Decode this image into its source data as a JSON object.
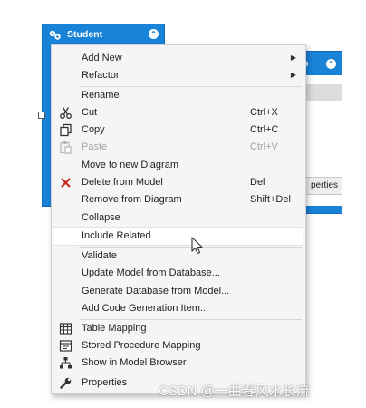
{
  "student_entity": {
    "title": "Student",
    "toggle": "⌃",
    "icon": "entity-icon"
  },
  "address_entity": {
    "title_fragment": "ess",
    "toggle": "⌃",
    "nav_fragment": "perties"
  },
  "menu": {
    "items": [
      {
        "label": "Add New",
        "submenu": true,
        "icon": null
      },
      {
        "label": "Refactor",
        "submenu": true,
        "icon": null
      },
      {
        "label": "Rename",
        "icon": null
      },
      {
        "label": "Cut",
        "shortcut": "Ctrl+X",
        "icon": "scissors-icon"
      },
      {
        "label": "Copy",
        "shortcut": "Ctrl+C",
        "icon": "copy-icon"
      },
      {
        "label": "Paste",
        "shortcut": "Ctrl+V",
        "icon": "paste-icon",
        "disabled": true
      },
      {
        "label": "Move to new Diagram",
        "icon": null
      },
      {
        "label": "Delete from Model",
        "shortcut": "Del",
        "icon": "delete-x-icon"
      },
      {
        "label": "Remove from Diagram",
        "shortcut": "Shift+Del",
        "icon": null
      },
      {
        "label": "Collapse",
        "icon": null
      },
      {
        "label": "Include Related",
        "icon": null,
        "hover": true
      },
      {
        "label": "Validate",
        "icon": null
      },
      {
        "label": "Update Model from Database...",
        "icon": null
      },
      {
        "label": "Generate Database from Model...",
        "icon": null
      },
      {
        "label": "Add Code Generation Item...",
        "icon": null
      },
      {
        "label": "Table Mapping",
        "icon": "table-mapping-icon"
      },
      {
        "label": "Stored Procedure Mapping",
        "icon": "stored-procedure-icon"
      },
      {
        "label": "Show in Model Browser",
        "icon": "model-browser-icon"
      },
      {
        "label": "Properties",
        "icon": "wrench-icon"
      }
    ]
  },
  "watermark": "CSDN @一曲春风水长流",
  "colors": {
    "accent": "#1883d7",
    "menu_bg": "#f5f5f5",
    "delete_red": "#c42b1c"
  }
}
